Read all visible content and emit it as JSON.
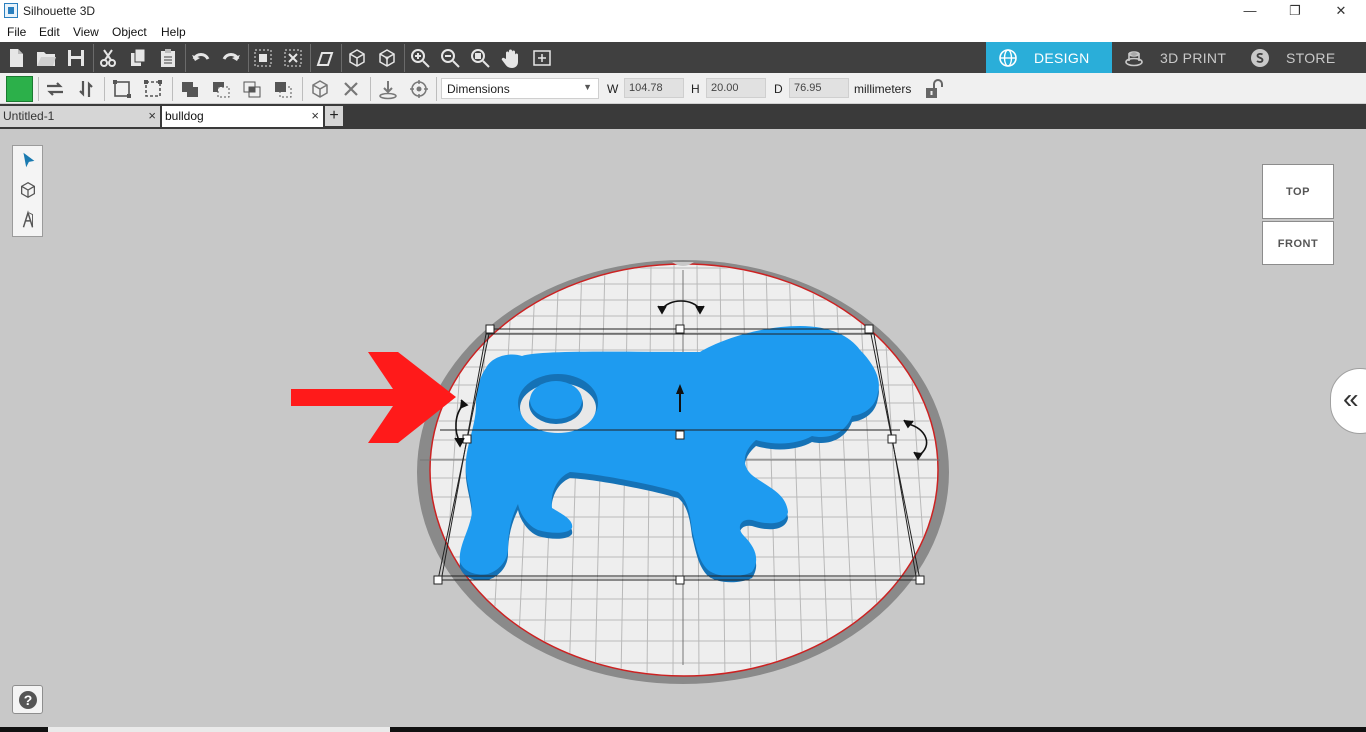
{
  "app": {
    "title": "Silhouette 3D"
  },
  "window_controls": {
    "minimize": "—",
    "restore": "❐",
    "close": "✕"
  },
  "menu": [
    "File",
    "Edit",
    "View",
    "Object",
    "Help"
  ],
  "mode_tabs": [
    {
      "label": "DESIGN",
      "active": true
    },
    {
      "label": "3D PRINT",
      "active": false
    },
    {
      "label": "STORE",
      "active": false
    }
  ],
  "colors": {
    "accent": "#2aaed9",
    "model": "#1e9bf0",
    "swatch": "#2cb04a",
    "plate_edge": "#cc2222",
    "arrow": "#ff1a1a"
  },
  "properties": {
    "mode_select": "Dimensions",
    "w_label": "W",
    "w_value": "104.78",
    "h_label": "H",
    "h_value": "20.00",
    "d_label": "D",
    "d_value": "76.95",
    "units": "millimeters"
  },
  "documents": [
    {
      "label": "Untitled-1",
      "active": false,
      "close": "×"
    },
    {
      "label": "bulldog",
      "active": true,
      "close": "×"
    }
  ],
  "add_tab": "+",
  "view_cube": {
    "top": "TOP",
    "front": "FRONT"
  },
  "collapse_label": "«",
  "help_label": "?"
}
